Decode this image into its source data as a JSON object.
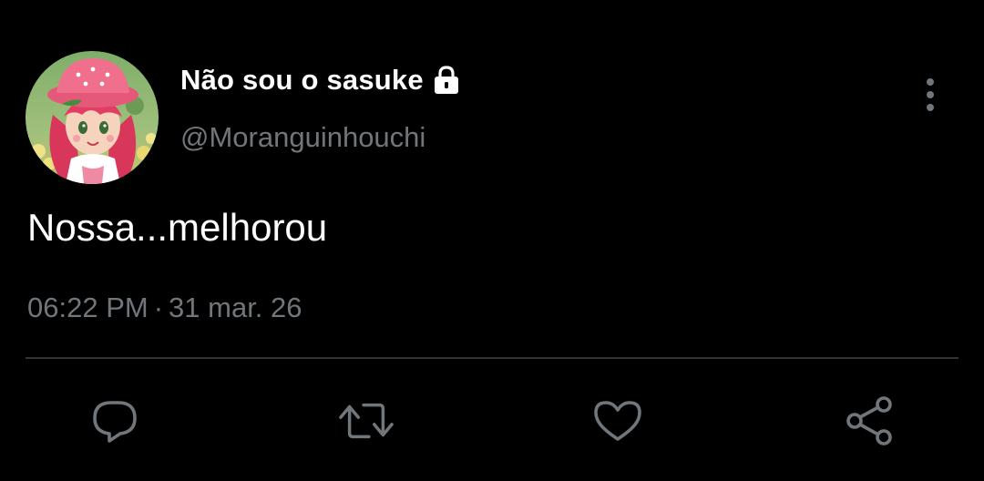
{
  "tweet": {
    "display_name": "Não sou o sasuke",
    "handle": "@Moranguinhouchi",
    "text": "Nossa...melhorou",
    "time": "06:22 PM",
    "separator": "·",
    "date": "31 mar. 26",
    "protected": true
  },
  "icons": {
    "avatar": "strawberry-shortcake-avatar",
    "lock": "lock-icon",
    "more": "more-vertical-icon",
    "reply": "reply-icon",
    "retweet": "retweet-icon",
    "like": "heart-icon",
    "share": "share-icon"
  },
  "colors": {
    "background": "#000000",
    "text_primary": "#ffffff",
    "text_secondary": "#71767b",
    "divider": "#2f3336",
    "icon": "#71767b"
  }
}
